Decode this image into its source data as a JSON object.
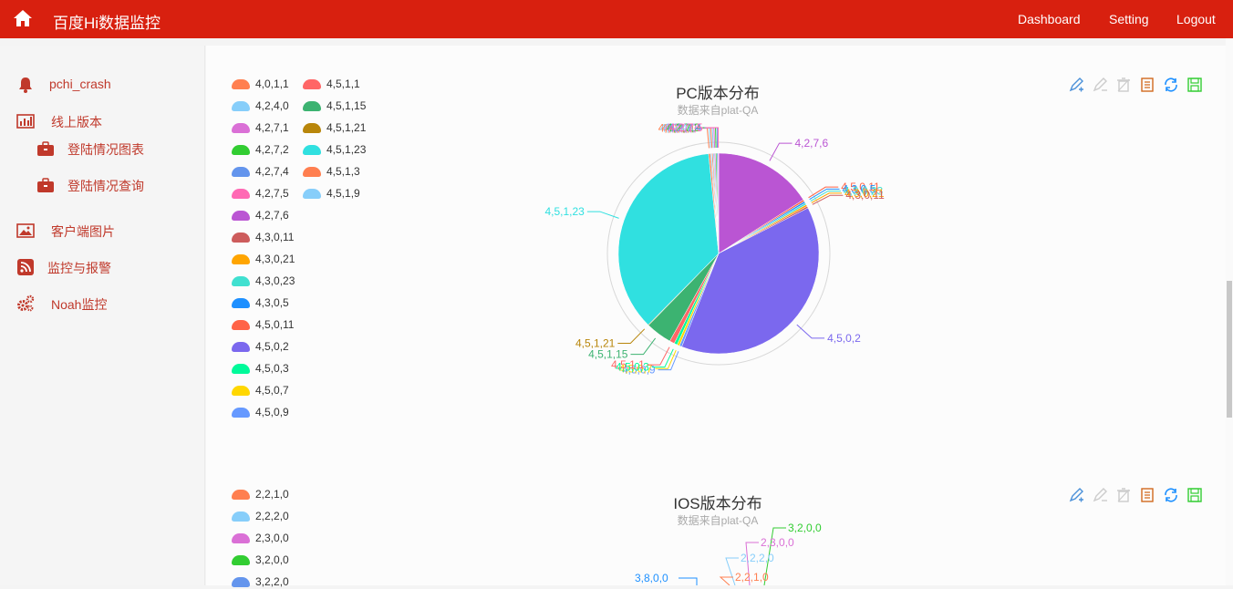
{
  "header": {
    "title": "百度Hi数据监控",
    "nav": [
      "Dashboard",
      "Setting",
      "Logout"
    ]
  },
  "sidebar": {
    "items": [
      {
        "label": "pchi_crash",
        "icon": "bell-icon"
      },
      {
        "label": "线上版本",
        "icon": "bar-chart-icon"
      },
      {
        "label": "登陆情况图表",
        "icon": "briefcase-icon"
      },
      {
        "label": "登陆情况查询",
        "icon": "briefcase-icon"
      },
      {
        "label": "客户端图片",
        "icon": "image-icon"
      },
      {
        "label": "监控与报警",
        "icon": "rss-icon"
      },
      {
        "label": "Noah监控",
        "icon": "gears-icon"
      }
    ]
  },
  "charts": [
    {
      "title": "PC版本分布",
      "subtitle": "数据来自plat-QA",
      "legend": [
        {
          "name": "4,0,1,1",
          "color": "#ff7f50"
        },
        {
          "name": "4,2,4,0",
          "color": "#87cefa"
        },
        {
          "name": "4,2,7,1",
          "color": "#da70d6"
        },
        {
          "name": "4,2,7,2",
          "color": "#32cd32"
        },
        {
          "name": "4,2,7,4",
          "color": "#6495ed"
        },
        {
          "name": "4,2,7,5",
          "color": "#ff69b4"
        },
        {
          "name": "4,2,7,6",
          "color": "#ba55d3"
        },
        {
          "name": "4,3,0,11",
          "color": "#cd5c5c"
        },
        {
          "name": "4,3,0,21",
          "color": "#ffa500"
        },
        {
          "name": "4,3,0,23",
          "color": "#40e0d0"
        },
        {
          "name": "4,3,0,5",
          "color": "#1e90ff"
        },
        {
          "name": "4,5,0,11",
          "color": "#ff6347"
        },
        {
          "name": "4,5,0,2",
          "color": "#7b68ee"
        },
        {
          "name": "4,5,0,3",
          "color": "#00fa9a"
        },
        {
          "name": "4,5,0,7",
          "color": "#ffd700"
        },
        {
          "name": "4,5,0,9",
          "color": "#6699ff"
        },
        {
          "name": "4,5,1,1",
          "color": "#ff6666"
        },
        {
          "name": "4,5,1,15",
          "color": "#3cb371"
        },
        {
          "name": "4,5,1,21",
          "color": "#b8860b"
        },
        {
          "name": "4,5,1,23",
          "color": "#30e0e0"
        },
        {
          "name": "4,5,1,3",
          "color": "#ff7f50"
        },
        {
          "name": "4,5,1,9",
          "color": "#87cefa"
        }
      ],
      "chart_data": {
        "type": "pie",
        "title": "PC版本分布",
        "subtitle": "数据来自plat-QA",
        "categories": [
          "4,2,7,6",
          "4,5,0,11",
          "4,3,0,5",
          "4,3,0,23",
          "4,3,0,21",
          "4,3,0,11",
          "4,5,0,2",
          "4,5,0,9",
          "4,5,0,7",
          "4,5,0,3",
          "4,5,1,1",
          "4,5,1,15",
          "4,5,1,21",
          "4,5,1,23",
          "4,5,1,3",
          "4,5,1,9",
          "4,0,1,1",
          "4,2,4,0",
          "4,2,7,1",
          "4,2,7,2",
          "4,2,7,4",
          "4,2,7,5"
        ],
        "values": [
          16.0,
          0.3,
          0.3,
          0.3,
          0.3,
          0.3,
          38.5,
          0.4,
          0.4,
          0.5,
          0.8,
          4.2,
          0.1,
          36.0,
          0.3,
          0.2,
          0.2,
          0.2,
          0.2,
          0.2,
          0.2,
          0.1
        ]
      }
    },
    {
      "title": "IOS版本分布",
      "subtitle": "数据来自plat-QA",
      "legend": [
        {
          "name": "2,2,1,0",
          "color": "#ff7f50"
        },
        {
          "name": "2,2,2,0",
          "color": "#87cefa"
        },
        {
          "name": "2,3,0,0",
          "color": "#da70d6"
        },
        {
          "name": "3,2,0,0",
          "color": "#32cd32"
        },
        {
          "name": "3,2,2,0",
          "color": "#6495ed"
        }
      ],
      "labels": [
        {
          "text": "3,2,0,0",
          "color": "#32cd32"
        },
        {
          "text": "2,3,0,0",
          "color": "#da70d6"
        },
        {
          "text": "2,2,2,0",
          "color": "#87cefa"
        },
        {
          "text": "2,2,1,0",
          "color": "#ff7f50"
        },
        {
          "text": "3,8,0,0",
          "color": "#1e90ff"
        }
      ]
    }
  ],
  "toolbox": [
    "mark-icon",
    "unmark-icon",
    "clear-icon",
    "data-view-icon",
    "refresh-icon",
    "save-icon"
  ]
}
